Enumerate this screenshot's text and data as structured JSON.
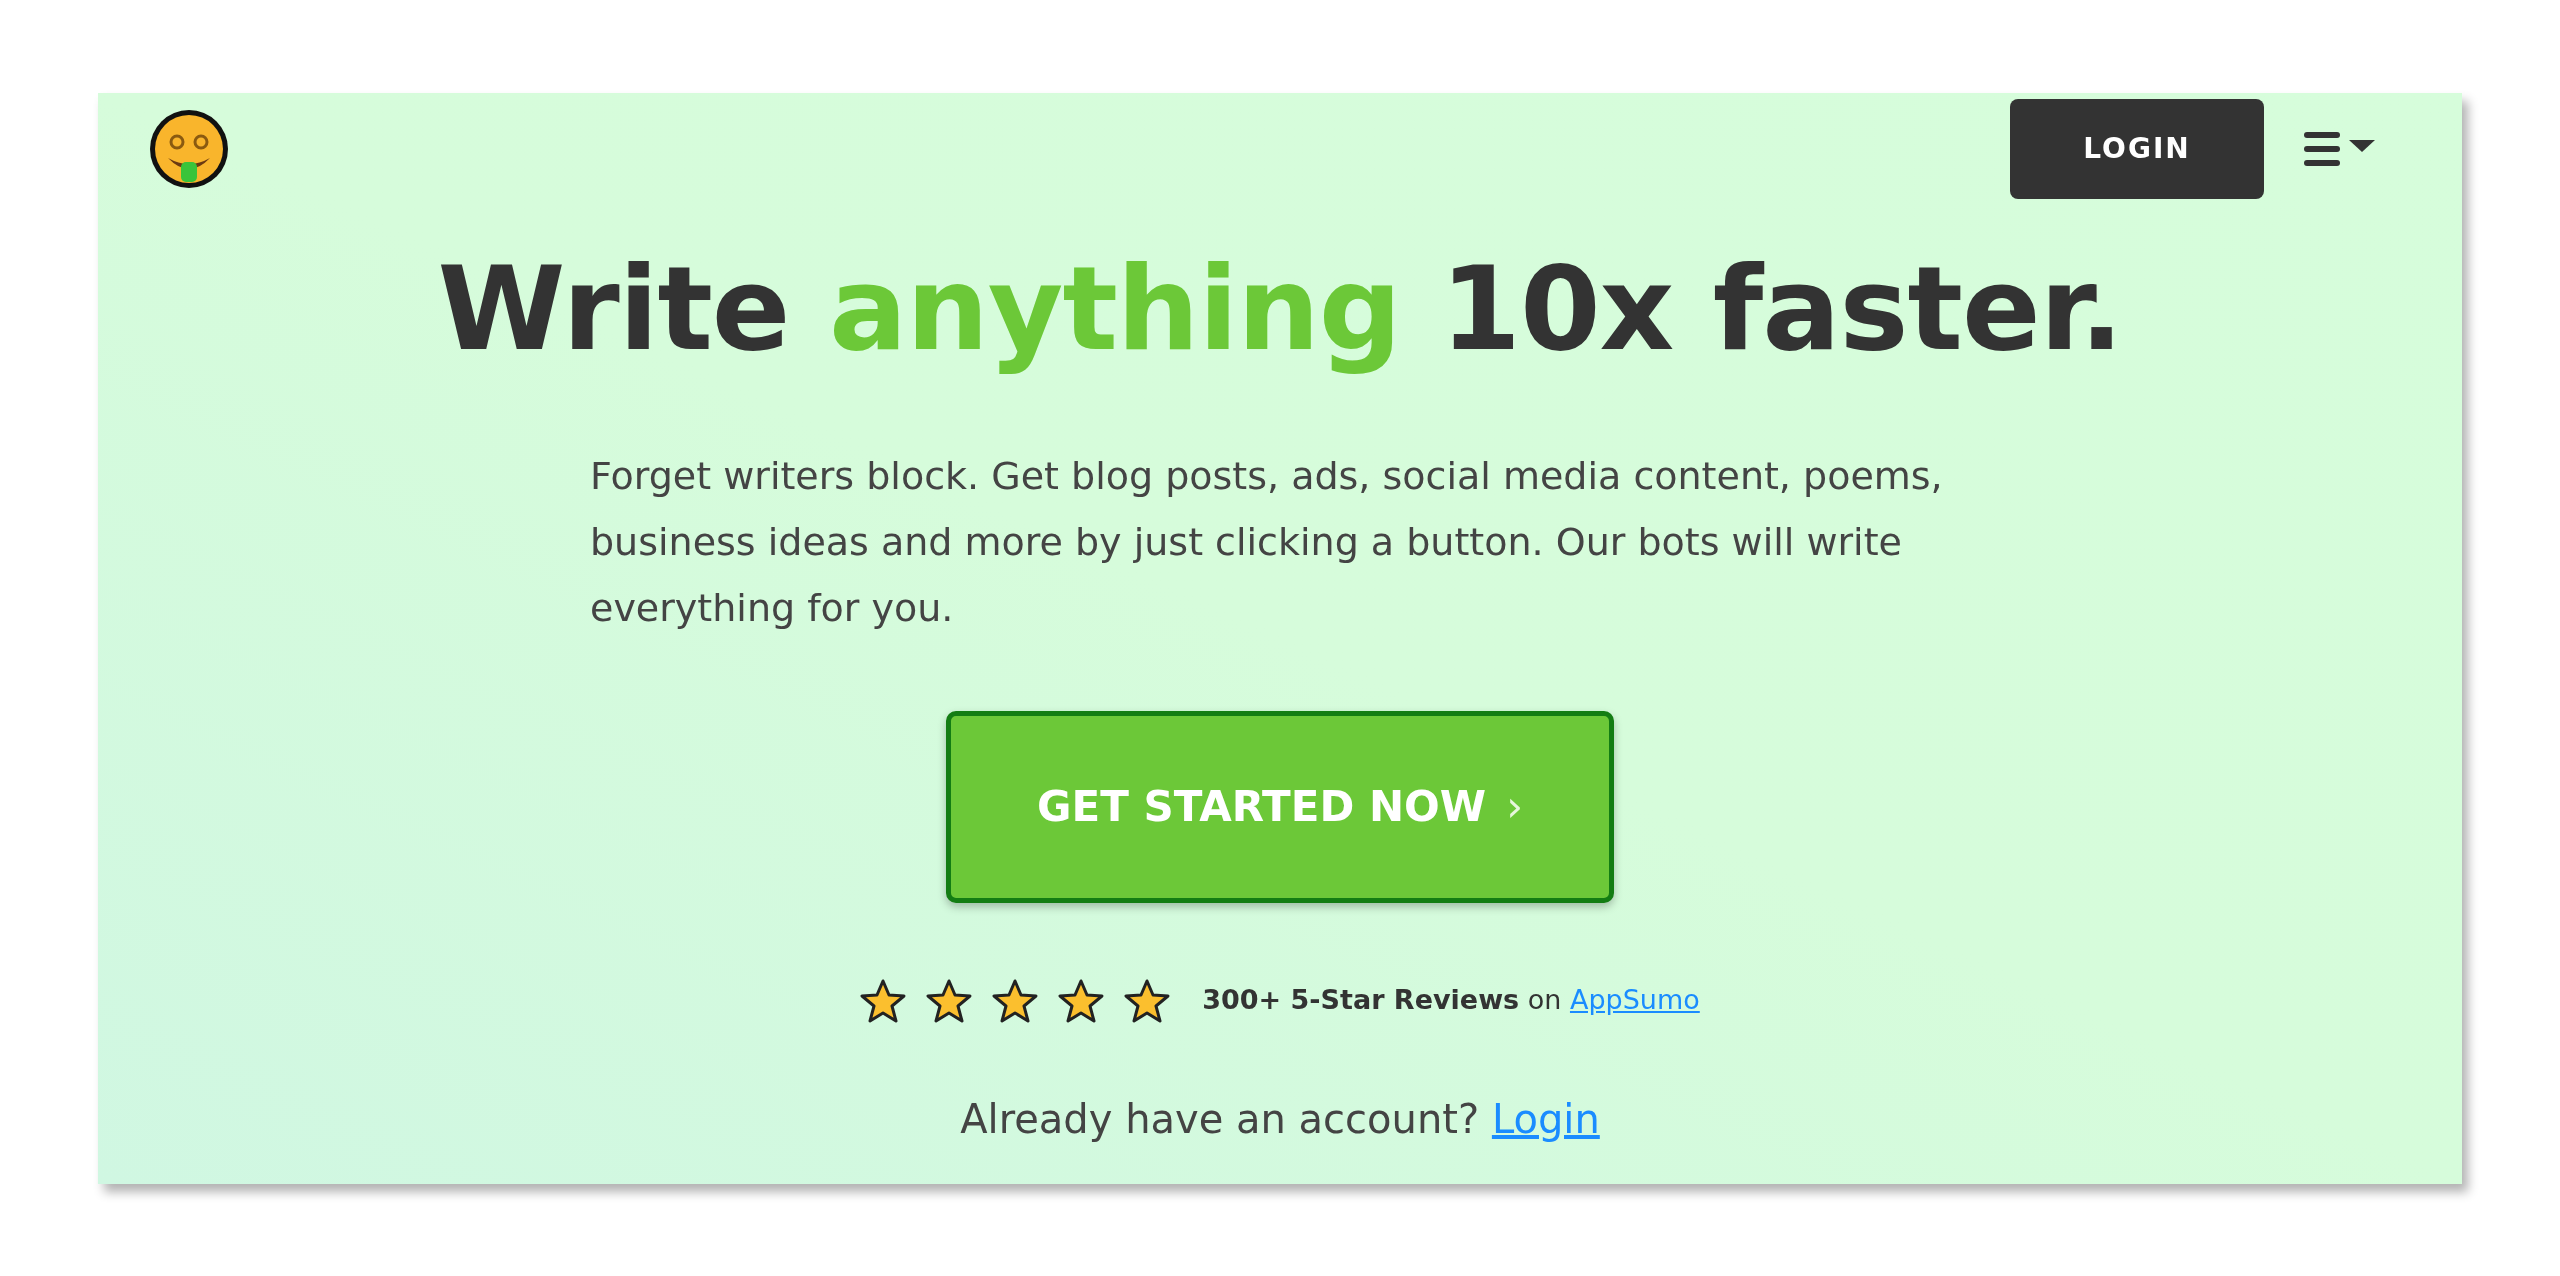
{
  "header": {
    "login_button": "LOGIN"
  },
  "headline": [
    {
      "text": "Write ",
      "highlight": false
    },
    {
      "text": "anything",
      "highlight": true
    },
    {
      "text": " 10x faster.",
      "highlight": false
    }
  ],
  "description": "Forget writers block. Get blog posts, ads, social media content, poems, business ideas and more by just clicking a button. Our bots will write everything for you.",
  "cta_button": {
    "label": "GET STARTED NOW",
    "chevron": "›"
  },
  "reviews": {
    "stars": 5,
    "text": "**300+ 5-Star Reviews** on ",
    "link": "AppSumo"
  },
  "account_prompt": {
    "text": "Already have an account? ",
    "link": "Login"
  }
}
